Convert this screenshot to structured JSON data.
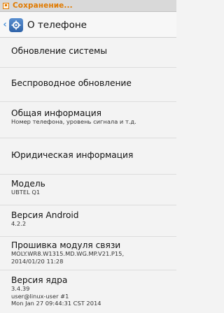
{
  "status_bar": {
    "text": "Сохранение..."
  },
  "action_bar": {
    "title": "О телефоне",
    "icon": "settings-icon",
    "back_icon": "back-arrow-icon"
  },
  "items": [
    {
      "title": "Обновление системы",
      "subtitle": []
    },
    {
      "title": "Беспроводное обновление",
      "subtitle": []
    },
    {
      "title": "Общая информация",
      "subtitle": [
        "Номер телефона, уровень сигнала и т.д."
      ]
    },
    {
      "title": "Юридическая информация",
      "subtitle": []
    },
    {
      "title": "Модель",
      "subtitle": [
        "UBTEL Q1"
      ]
    },
    {
      "title": "Версия Android",
      "subtitle": [
        "4.2.2"
      ]
    },
    {
      "title": "Прошивка модуля связи",
      "subtitle": [
        "MOLY.WR8.W1315.MD.WG.MP.V21.P15,",
        "2014/01/20 11:28"
      ]
    },
    {
      "title": "Версия ядра",
      "subtitle": [
        "3.4.39",
        "user@linux-user #1",
        "Mon Jan 27 09:44:31 CST 2014"
      ]
    }
  ],
  "colors": {
    "accent_status": "#e07a00",
    "settings_icon_blue": "#2f63a8"
  }
}
